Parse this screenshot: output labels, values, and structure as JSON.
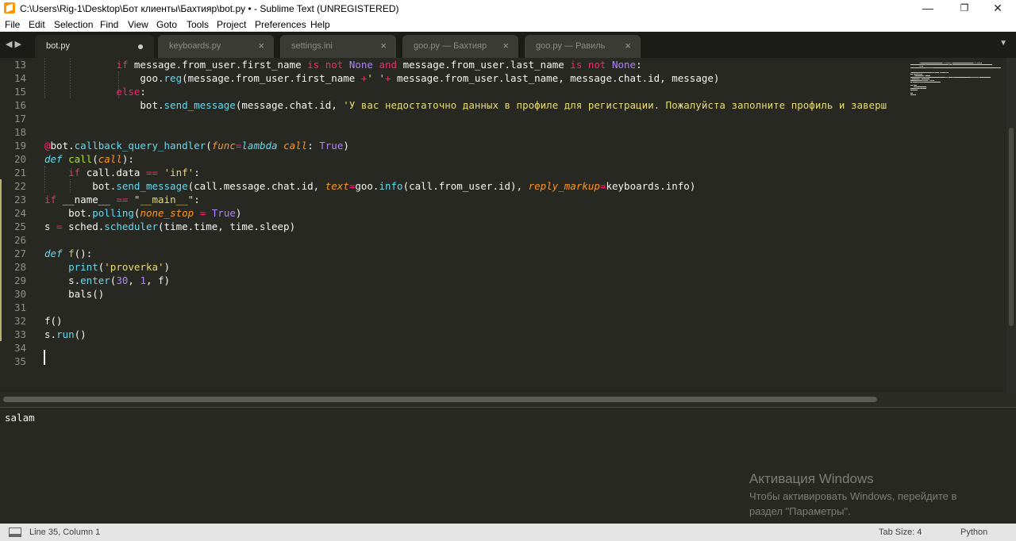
{
  "window": {
    "title": "C:\\Users\\Rig-1\\Desktop\\Бот клиенты\\Бахтияр\\bot.py • - Sublime Text (UNREGISTERED)",
    "min_icon": "minimize-icon",
    "max_icon": "maximize-icon",
    "close_icon": "close-icon"
  },
  "menu": [
    "File",
    "Edit",
    "Selection",
    "Find",
    "View",
    "Goto",
    "Tools",
    "Project",
    "Preferences",
    "Help"
  ],
  "tabs": [
    {
      "label": "bot.py",
      "active": true,
      "dirty": true
    },
    {
      "label": "keyboards.py",
      "active": false,
      "dirty": false
    },
    {
      "label": "settings.ini",
      "active": false,
      "dirty": false
    },
    {
      "label": "goo.py — Бахтияр",
      "active": false,
      "dirty": false
    },
    {
      "label": "goo.py — Равиль",
      "active": false,
      "dirty": false
    }
  ],
  "editor": {
    "lines": [
      {
        "n": "13",
        "mod": false,
        "tokens": [
          [
            "",
            "            "
          ],
          [
            "kw",
            "if"
          ],
          [
            "",
            " message.from_user.first_name "
          ],
          [
            "kw",
            "is not"
          ],
          [
            "num",
            " None "
          ],
          [
            "kw",
            "and"
          ],
          [
            "",
            " message.from_user.last_name "
          ],
          [
            "kw",
            "is not"
          ],
          [
            "num",
            " None"
          ],
          [
            "",
            ":"
          ]
        ]
      },
      {
        "n": "14",
        "mod": false,
        "tokens": [
          [
            "",
            "                goo."
          ],
          [
            "fn",
            "reg"
          ],
          [
            "",
            "(message.from_user.first_name "
          ],
          [
            "kw",
            "+"
          ],
          [
            "str",
            "' '"
          ],
          [
            "kw",
            "+"
          ],
          [
            "",
            " message.from_user.last_name, message.chat.id, message)"
          ]
        ]
      },
      {
        "n": "15",
        "mod": false,
        "tokens": [
          [
            "",
            "            "
          ],
          [
            "kw",
            "else"
          ],
          [
            "",
            ":"
          ]
        ]
      },
      {
        "n": "16",
        "mod": false,
        "tokens": [
          [
            "",
            "                bot."
          ],
          [
            "fn",
            "send_message"
          ],
          [
            "",
            "(message.chat.id, "
          ],
          [
            "str",
            "'У вас недостаточно данных в профиле для регистрации. Пожалуйста заполните профиль и заверш"
          ]
        ]
      },
      {
        "n": "17",
        "mod": false,
        "tokens": []
      },
      {
        "n": "18",
        "mod": false,
        "tokens": []
      },
      {
        "n": "19",
        "mod": false,
        "tokens": [
          [
            "kw",
            "@"
          ],
          [
            "",
            "bot."
          ],
          [
            "fn",
            "callback_query_handler"
          ],
          [
            "",
            "("
          ],
          [
            "param",
            "func"
          ],
          [
            "kw",
            "="
          ],
          [
            "storage",
            "lambda"
          ],
          [
            "",
            " "
          ],
          [
            "param",
            "call"
          ],
          [
            "",
            ": "
          ],
          [
            "num",
            "True"
          ],
          [
            "",
            ")"
          ]
        ]
      },
      {
        "n": "20",
        "mod": false,
        "tokens": [
          [
            "storage",
            "def"
          ],
          [
            "",
            " "
          ],
          [
            "def",
            "call"
          ],
          [
            "",
            "("
          ],
          [
            "param",
            "call"
          ],
          [
            "",
            "):"
          ]
        ]
      },
      {
        "n": "21",
        "mod": false,
        "tokens": [
          [
            "",
            "    "
          ],
          [
            "kw",
            "if"
          ],
          [
            "",
            " call.data "
          ],
          [
            "kw",
            "=="
          ],
          [
            "",
            " "
          ],
          [
            "str",
            "'inf'"
          ],
          [
            "",
            ":"
          ]
        ]
      },
      {
        "n": "22",
        "mod": true,
        "tokens": [
          [
            "",
            "        bot."
          ],
          [
            "fn",
            "send_message"
          ],
          [
            "",
            "(call.message.chat.id, "
          ],
          [
            "param",
            "text"
          ],
          [
            "kw",
            "="
          ],
          [
            "",
            "goo."
          ],
          [
            "fn",
            "info"
          ],
          [
            "",
            "(call.from_user.id), "
          ],
          [
            "param",
            "reply_markup"
          ],
          [
            "kw",
            "="
          ],
          [
            "",
            "keyboards.info)"
          ]
        ]
      },
      {
        "n": "23",
        "mod": true,
        "tokens": [
          [
            "kw",
            "if"
          ],
          [
            "",
            " __name__ "
          ],
          [
            "kw",
            "=="
          ],
          [
            "",
            " "
          ],
          [
            "str",
            "\"__main__\""
          ],
          [
            "",
            ":"
          ]
        ]
      },
      {
        "n": "24",
        "mod": true,
        "tokens": [
          [
            "",
            "    bot."
          ],
          [
            "fn",
            "polling"
          ],
          [
            "",
            "("
          ],
          [
            "param",
            "none_stop"
          ],
          [
            "",
            " "
          ],
          [
            "kw",
            "="
          ],
          [
            "",
            " "
          ],
          [
            "num",
            "True"
          ],
          [
            "",
            ")"
          ]
        ]
      },
      {
        "n": "25",
        "mod": true,
        "tokens": [
          [
            "",
            "s "
          ],
          [
            "kw",
            "="
          ],
          [
            "",
            " sched."
          ],
          [
            "fn",
            "scheduler"
          ],
          [
            "",
            "(time.time, time.sleep)"
          ]
        ]
      },
      {
        "n": "26",
        "mod": true,
        "tokens": []
      },
      {
        "n": "27",
        "mod": true,
        "tokens": [
          [
            "storage",
            "def"
          ],
          [
            "",
            " "
          ],
          [
            "def",
            "f"
          ],
          [
            "",
            "():"
          ]
        ]
      },
      {
        "n": "28",
        "mod": true,
        "tokens": [
          [
            "",
            "    "
          ],
          [
            "fn",
            "print"
          ],
          [
            "",
            "("
          ],
          [
            "str",
            "'proverka'"
          ],
          [
            "",
            ")"
          ]
        ]
      },
      {
        "n": "29",
        "mod": true,
        "tokens": [
          [
            "",
            "    s."
          ],
          [
            "fn",
            "enter"
          ],
          [
            "",
            "("
          ],
          [
            "num",
            "30"
          ],
          [
            "",
            ", "
          ],
          [
            "num",
            "1"
          ],
          [
            "",
            ", f)"
          ]
        ]
      },
      {
        "n": "30",
        "mod": true,
        "tokens": [
          [
            "",
            "    bals()"
          ]
        ]
      },
      {
        "n": "31",
        "mod": true,
        "tokens": []
      },
      {
        "n": "32",
        "mod": true,
        "tokens": [
          [
            "",
            "f()"
          ]
        ]
      },
      {
        "n": "33",
        "mod": true,
        "tokens": [
          [
            "",
            "s."
          ],
          [
            "fn",
            "run"
          ],
          [
            "",
            "()"
          ]
        ]
      },
      {
        "n": "34",
        "mod": false,
        "tokens": []
      },
      {
        "n": "35",
        "mod": false,
        "tokens": []
      }
    ]
  },
  "panel": {
    "output": "salam",
    "activation_title": "Активация Windows",
    "activation_text": "Чтобы активировать Windows, перейдите в раздел \"Параметры\"."
  },
  "status": {
    "position": "Line 35, Column 1",
    "tab_size": "Tab Size: 4",
    "syntax": "Python"
  },
  "colors": {
    "background": "#272822",
    "keyword": "#f92672",
    "function": "#66d9ef",
    "string": "#e6db74",
    "number": "#ae81ff",
    "parameter": "#fd971f",
    "decorator_name": "#a6e22e"
  }
}
